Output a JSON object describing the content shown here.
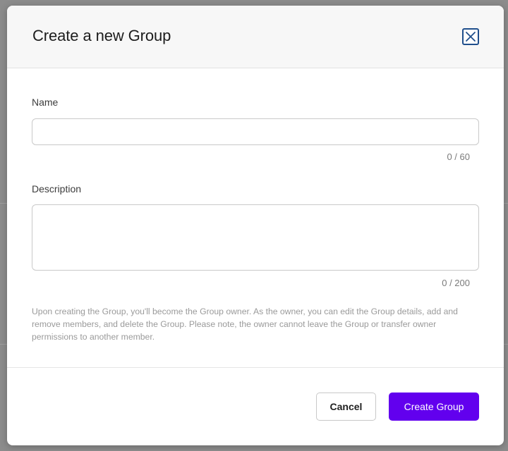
{
  "dialog": {
    "title": "Create a new Group",
    "name_label": "Name",
    "name_value": "",
    "name_counter": "0 / 60",
    "description_label": "Description",
    "description_value": "",
    "description_counter": "0 / 200",
    "note": "Upon creating the Group, you'll become the Group owner. As the owner, you can edit the Group details, add and remove members, and delete the Group. Please note, the owner cannot leave the Group or transfer owner permissions to another member.",
    "cancel_label": "Cancel",
    "create_label": "Create Group",
    "close_icon": "close-icon"
  },
  "colors": {
    "accent": "#6200ee",
    "close_border": "#1f4e8c",
    "overlay": "#8c8c8c"
  }
}
